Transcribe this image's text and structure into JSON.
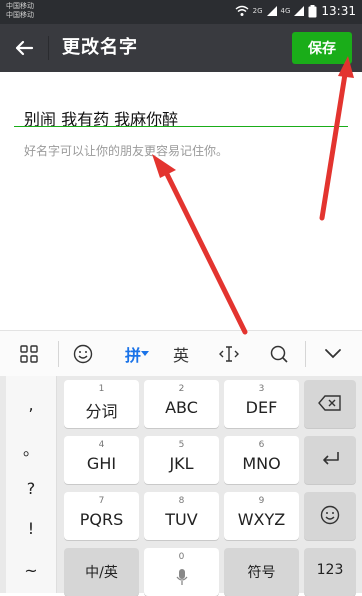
{
  "status_bar": {
    "carrier_1": "中国移动",
    "carrier_2": "中国移动",
    "network_small_1": "2G",
    "network_small_2": "4G",
    "time": "13:31"
  },
  "app_bar": {
    "title": "更改名字",
    "save_label": "保存",
    "accent_color": "#1aad19"
  },
  "form": {
    "name_value": "别闹 我有药 我麻你醉",
    "hint": "好名字可以让你的朋友更容易记住你。"
  },
  "keyboard_toolbar": {
    "pinyin_label": "拼",
    "english_label": "英"
  },
  "keyboard": {
    "punctuation": [
      ",",
      "。",
      "?",
      "!",
      "~"
    ],
    "rows": [
      [
        {
          "num": "1",
          "label": "分词"
        },
        {
          "num": "2",
          "label": "ABC"
        },
        {
          "num": "3",
          "label": "DEF"
        }
      ],
      [
        {
          "num": "4",
          "label": "GHI"
        },
        {
          "num": "5",
          "label": "JKL"
        },
        {
          "num": "6",
          "label": "MNO"
        }
      ],
      [
        {
          "num": "7",
          "label": "PQRS"
        },
        {
          "num": "8",
          "label": "TUV"
        },
        {
          "num": "9",
          "label": "WXYZ"
        }
      ]
    ],
    "bottom": {
      "zh_en_label": "中/英",
      "zero_num": "0",
      "symbol_label": "符号",
      "num_label": "123"
    }
  }
}
